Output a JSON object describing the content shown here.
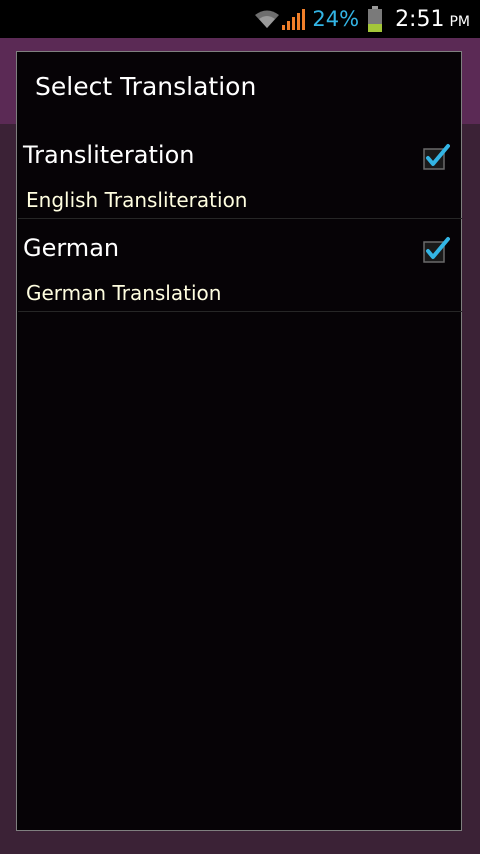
{
  "status_bar": {
    "battery_percent": "24%",
    "time": "2:51",
    "ampm": "PM",
    "icons": [
      "wifi-icon",
      "signal-icon",
      "battery-icon"
    ],
    "accent_color": "#33b5e5"
  },
  "dialog": {
    "title": "Select Translation",
    "items": [
      {
        "title": "Transliteration",
        "subtitle": "English Transliteration",
        "checked": true
      },
      {
        "title": "German",
        "subtitle": "German Translation",
        "checked": true
      }
    ]
  }
}
